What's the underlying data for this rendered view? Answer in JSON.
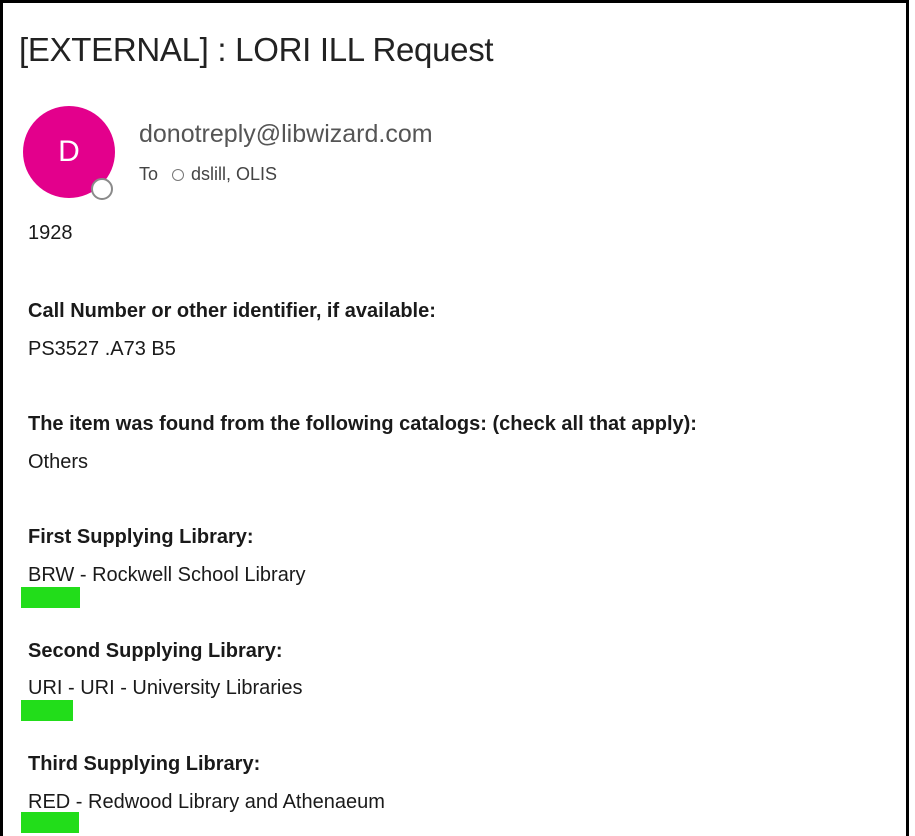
{
  "email": {
    "subject": "[EXTERNAL] : LORI ILL Request",
    "avatar_initial": "D",
    "avatar_color": "#e3008c",
    "sender": "donotreply@libwizard.com",
    "to_label": "To",
    "recipients": "dslill, OLIS"
  },
  "body": {
    "year": "1928",
    "call_number_label": "Call Number or other identifier, if available:",
    "call_number_value": "PS3527 .A73 B5",
    "catalogs_label": "The item was found from the following catalogs: (check all that apply):",
    "catalogs_value": "Others",
    "first_library_label": "First Supplying Library:",
    "first_library_value": "BRW - Rockwell School Library",
    "second_library_label": "Second Supplying Library:",
    "second_library_value": "URI - URI - University Libraries",
    "third_library_label": "Third Supplying Library:",
    "third_library_value": "RED - Redwood Library and Athenaeum"
  },
  "highlight_color": "#22dd1a"
}
